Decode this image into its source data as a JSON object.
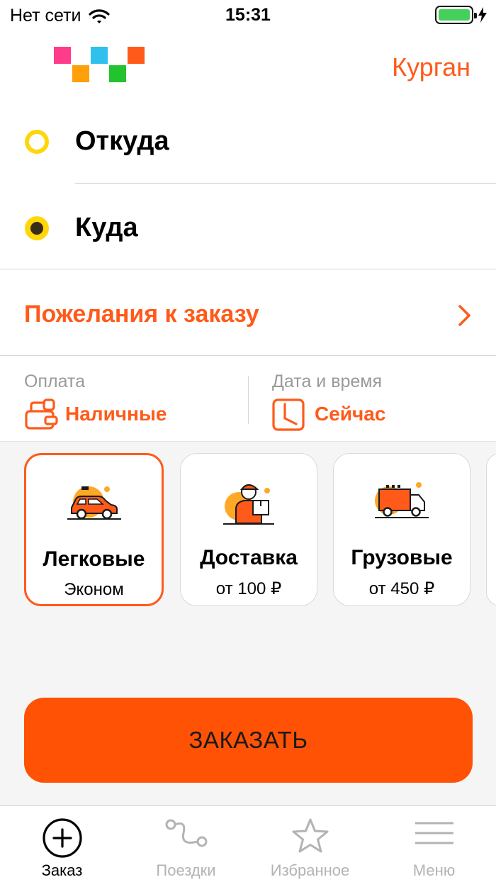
{
  "status_bar": {
    "carrier": "Нет сети",
    "time": "15:31"
  },
  "header": {
    "city": "Курган"
  },
  "route": {
    "from_label": "Откуда",
    "to_label": "Куда"
  },
  "wishes": {
    "label": "Пожелания к заказу"
  },
  "payment": {
    "caption": "Оплата",
    "value": "Наличные"
  },
  "datetime": {
    "caption": "Дата и время",
    "value": "Сейчас"
  },
  "tariffs": [
    {
      "title": "Легковые",
      "subtitle": "Эконом",
      "selected": true
    },
    {
      "title": "Доставка",
      "subtitle": "от 100 ₽",
      "selected": false
    },
    {
      "title": "Грузовые",
      "subtitle": "от 450 ₽",
      "selected": false
    }
  ],
  "order_button": {
    "label": "ЗАКАЗАТЬ"
  },
  "tabbar": {
    "items": [
      {
        "label": "Заказ",
        "icon": "plus-circle-icon",
        "active": true
      },
      {
        "label": "Поездки",
        "icon": "route-icon",
        "active": false
      },
      {
        "label": "Избранное",
        "icon": "star-icon",
        "active": false
      },
      {
        "label": "Меню",
        "icon": "menu-icon",
        "active": false
      }
    ]
  },
  "colors": {
    "accent": "#ff5a1a",
    "button": "#ff5205",
    "from_dot": "#ffd60a",
    "battery": "#44d05a",
    "logo": [
      "#ff3b8b",
      "#ff9f0a",
      "#30c0ee",
      "#22c32e",
      "#ff5a1a"
    ]
  }
}
